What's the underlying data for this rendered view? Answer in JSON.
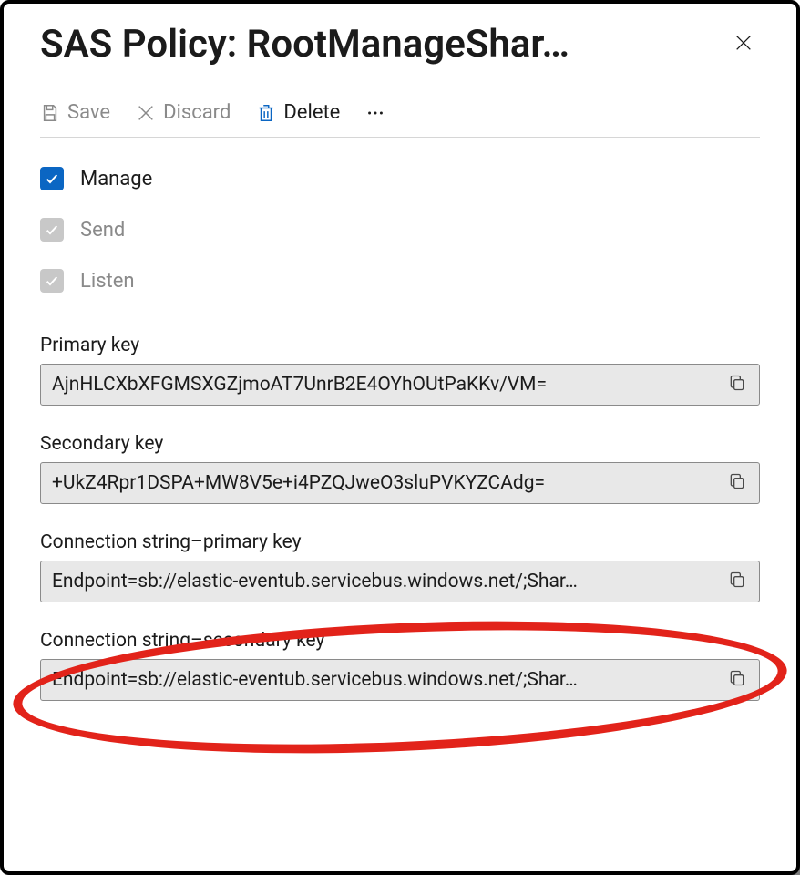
{
  "header": {
    "title": "SAS Policy: RootManageShar…"
  },
  "toolbar": {
    "save": "Save",
    "discard": "Discard",
    "delete": "Delete"
  },
  "claims": {
    "manage": "Manage",
    "send": "Send",
    "listen": "Listen"
  },
  "fields": {
    "primary_key": {
      "label": "Primary key",
      "value": "AjnHLCXbXFGMSXGZjmoAT7UnrB2E4OYhOUtPaKKv/VM="
    },
    "secondary_key": {
      "label": "Secondary key",
      "value": "+UkZ4Rpr1DSPA+MW8V5e+i4PZQJweO3sluPVKYZCAdg="
    },
    "conn_primary": {
      "label": "Connection string–primary key",
      "value": "Endpoint=sb://elastic-eventub.servicebus.windows.net/;Shar…"
    },
    "conn_secondary": {
      "label": "Connection string–secondary key",
      "value": "Endpoint=sb://elastic-eventub.servicebus.windows.net/;Shar…"
    }
  }
}
